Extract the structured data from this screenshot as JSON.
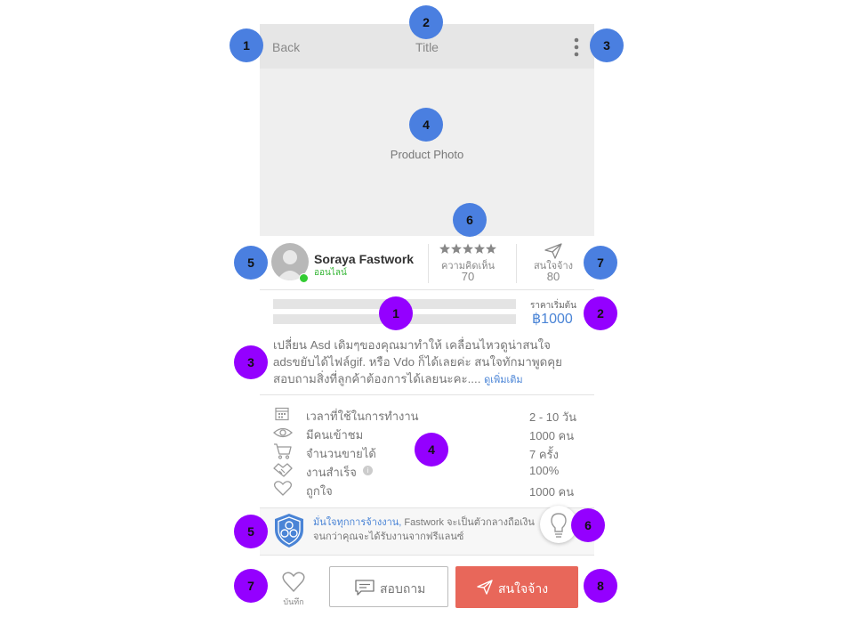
{
  "header": {
    "back_label": "Back",
    "title": "Title"
  },
  "photo": {
    "label": "Product Photo"
  },
  "seller": {
    "name": "Soraya Fastwork",
    "status": "ออนไลน์"
  },
  "rating": {
    "label": "ความคิดเห็น",
    "count": "70"
  },
  "interest": {
    "label": "สนใจจ้าง",
    "count": "80"
  },
  "price": {
    "label": "ราคาเริ่มต้น",
    "value": "฿1000"
  },
  "description": {
    "line1": "เปลี่ยน Asd เดิมๆของคุณมาทำให้ เคลื่อนไหวดูน่าสนใจ",
    "line2": "adsขยับได้ไฟล์gif. หรือ Vdo ก็ได้เลยค่ะ สนใจทักมาพูดคุย",
    "line3": "สอบถามสิ่งที่ลูกค้าต้องการได้เลยนะคะ....",
    "more": "ดูเพิ่มเติม"
  },
  "details": [
    {
      "icon": "calendar-icon",
      "label": "เวลาที่ใช้ในการทำงาน",
      "value": "2 - 10 วัน"
    },
    {
      "icon": "eye-icon",
      "label": "มีคนเข้าชม",
      "value": "1000 คน"
    },
    {
      "icon": "cart-icon",
      "label": "จำนวนขายได้",
      "value": "7 ครั้ง"
    },
    {
      "icon": "handshake-icon",
      "label": "งานสำเร็จ",
      "value": "100%"
    },
    {
      "icon": "heart-icon",
      "label": "ถูกใจ",
      "value": "1000 คน"
    }
  ],
  "guarantee": {
    "highlight": "มั่นใจทุกการจ้างงาน,",
    "text1": " Fastwork จะเป็นตัวกลางถือเงิน",
    "text2": "จนกว่าคุณจะได้รับงานจากฟรีแลนซ์"
  },
  "actions": {
    "save_label": "บันทึก",
    "ask_label": "สอบถาม",
    "hire_label": "สนใจจ้าง"
  },
  "markers_blue": [
    "1",
    "2",
    "3",
    "4",
    "5",
    "6",
    "7"
  ],
  "markers_purple": [
    "1",
    "2",
    "3",
    "4",
    "5",
    "6",
    "7",
    "8"
  ],
  "colors": {
    "blue_marker": "#4a7fe0",
    "purple_marker": "#9400ff",
    "hire_button": "#e8675a",
    "link_blue": "#4a84d6",
    "online_green": "#33cc33"
  }
}
